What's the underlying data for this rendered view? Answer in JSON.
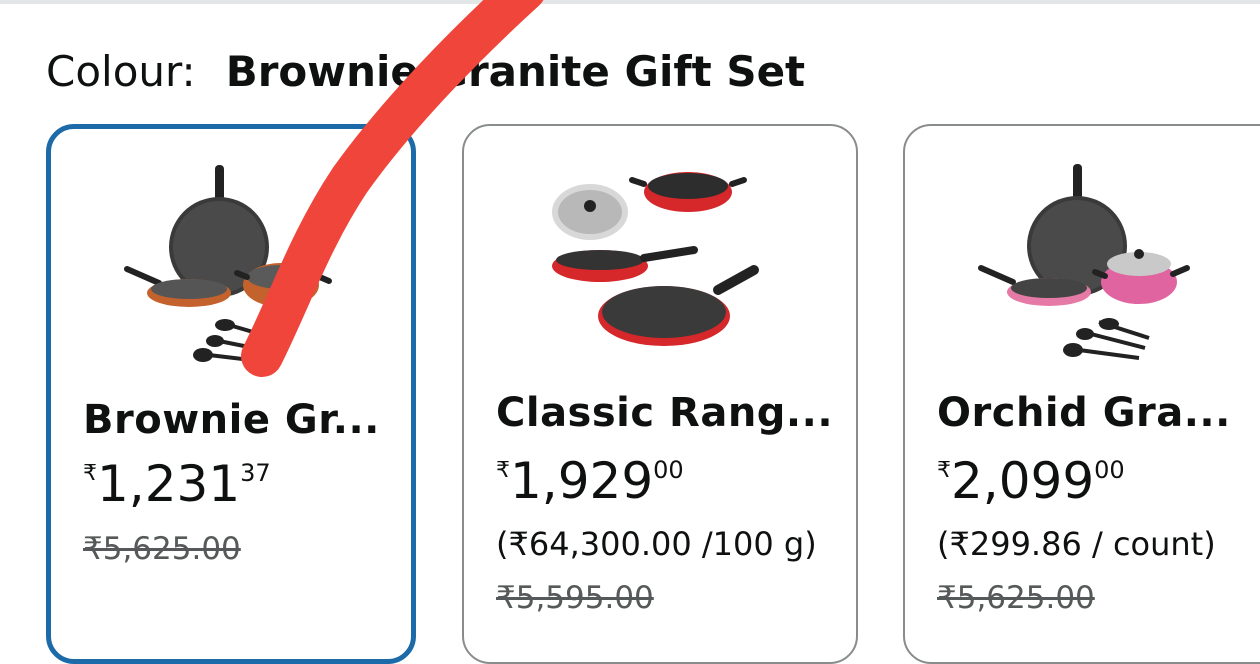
{
  "colour": {
    "label": "Colour:",
    "value": "Brownie Granite Gift Set"
  },
  "options": [
    {
      "title": "Brownie Gr...",
      "price_symbol": "₹",
      "price_whole": "1,231",
      "price_fraction": "37",
      "unit_price": "",
      "mrp": "₹5,625.00",
      "selected": true,
      "image_icon": "cookware-set-brownie-image"
    },
    {
      "title": "Classic Rang...",
      "price_symbol": "₹",
      "price_whole": "1,929",
      "price_fraction": "00",
      "unit_price": "(₹64,300.00 /100 g)",
      "mrp": "₹5,595.00",
      "selected": false,
      "image_icon": "cookware-set-red-image"
    },
    {
      "title": "Orchid Gra...",
      "price_symbol": "₹",
      "price_whole": "2,099",
      "price_fraction": "00",
      "unit_price": "(₹299.86 / count)",
      "mrp": "₹5,625.00",
      "selected": false,
      "image_icon": "cookware-set-orchid-image"
    }
  ],
  "colors": {
    "selected_border": "#1c6aa8",
    "card_border": "#888c8c",
    "annotation_stroke": "#f0453a",
    "strike_text": "#565959"
  }
}
